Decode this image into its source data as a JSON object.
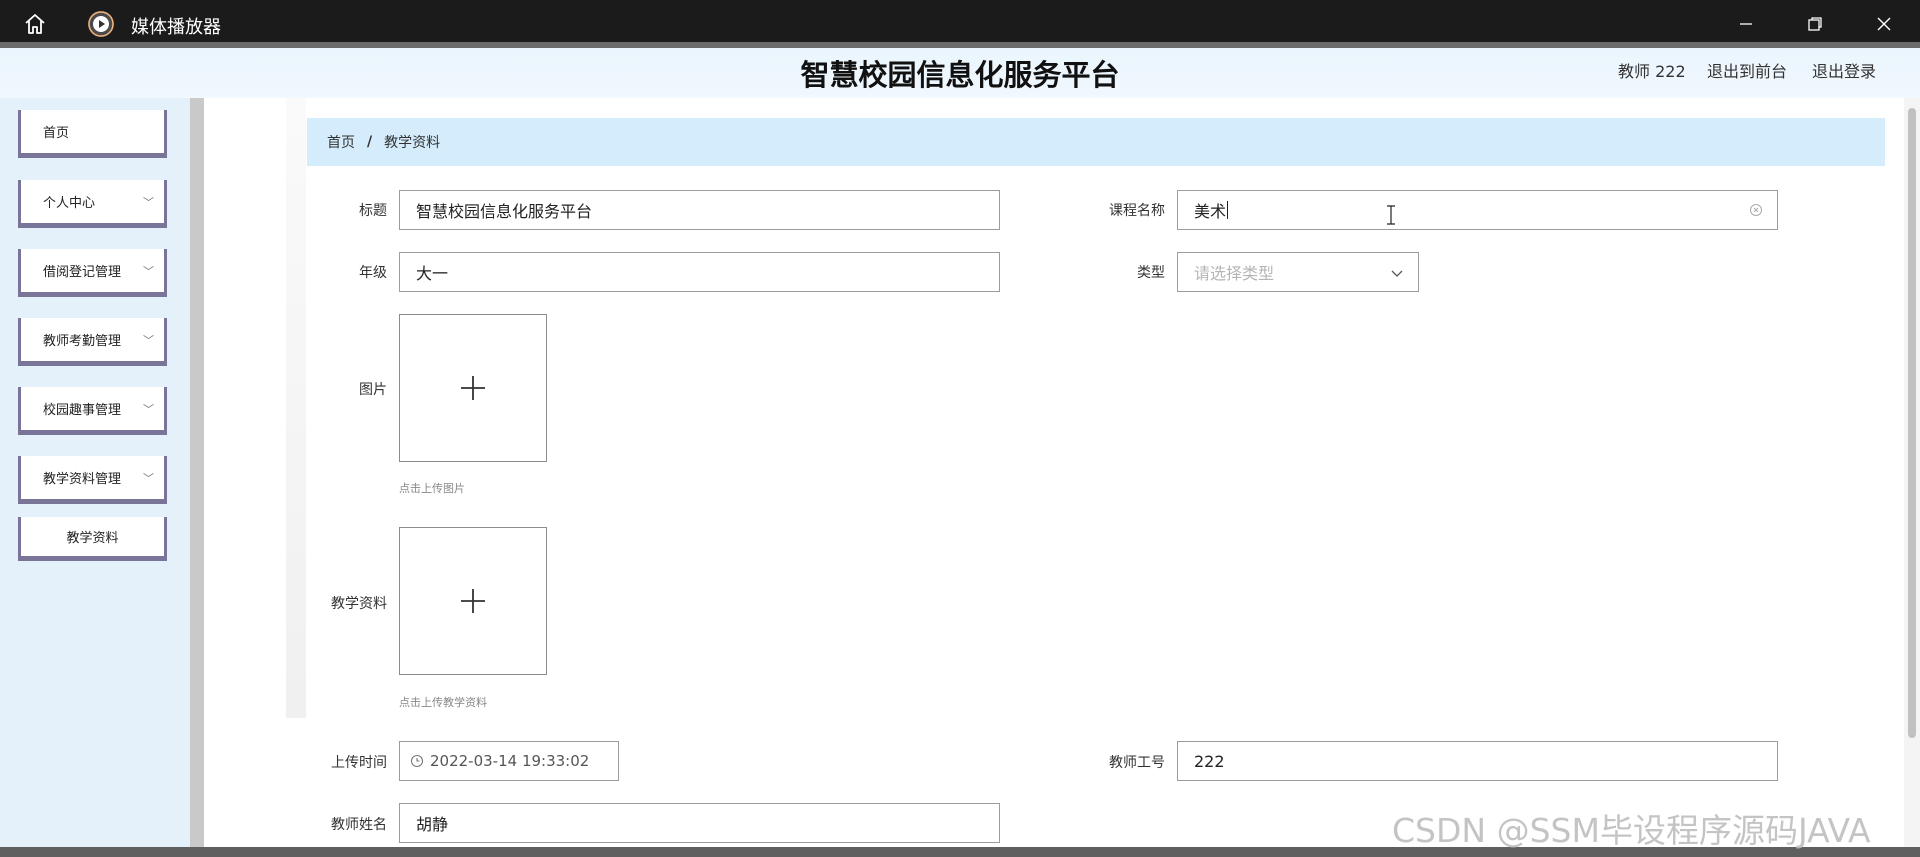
{
  "window": {
    "app_title": "媒体播放器",
    "icons": {
      "home": "home-icon",
      "app": "play-icon",
      "minimize": "minimize-icon",
      "maximize": "restore-icon",
      "close": "close-icon"
    }
  },
  "header": {
    "title": "智慧校园信息化服务平台",
    "user": "教师 222",
    "to_front": "退出到前台",
    "logout": "退出登录"
  },
  "sidebar": {
    "items": [
      {
        "label": "首页",
        "has_chevron": false
      },
      {
        "label": "个人中心",
        "has_chevron": true
      },
      {
        "label": "借阅登记管理",
        "has_chevron": true
      },
      {
        "label": "教师考勤管理",
        "has_chevron": true
      },
      {
        "label": "校园趣事管理",
        "has_chevron": true
      },
      {
        "label": "教学资料管理",
        "has_chevron": true
      }
    ],
    "sub_item": "教学资料"
  },
  "breadcrumb": {
    "home": "首页",
    "separator": "/",
    "current": "教学资料"
  },
  "form": {
    "title_label": "标题",
    "title_value": "智慧校园信息化服务平台",
    "course_label": "课程名称",
    "course_value": "美术",
    "grade_label": "年级",
    "grade_value": "大一",
    "type_label": "类型",
    "type_placeholder": "请选择类型",
    "image_label": "图片",
    "image_hint": "点击上传图片",
    "material_label": "教学资料",
    "material_hint": "点击上传教学资料",
    "upload_time_label": "上传时间",
    "upload_time_value": "2022-03-14 19:33:02",
    "teacher_id_label": "教师工号",
    "teacher_id_value": "222",
    "teacher_name_label": "教师姓名",
    "teacher_name_value": "胡静"
  },
  "watermark": "CSDN @SSM毕设程序源码JAVA"
}
